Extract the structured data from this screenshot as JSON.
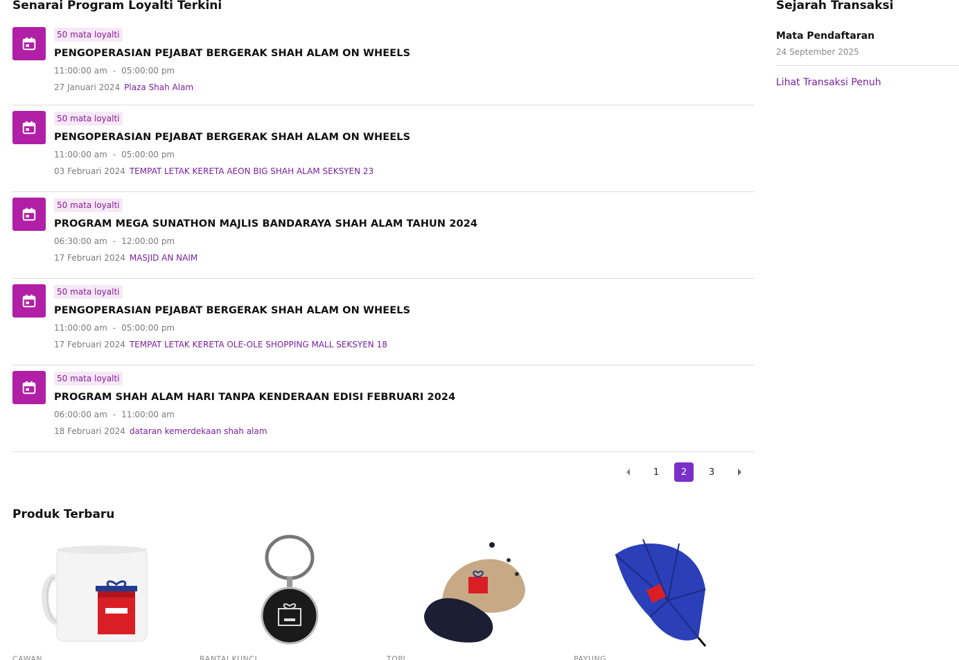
{
  "main": {
    "title": "Senarai Program Loyalti Terkini",
    "programs": [
      {
        "badge": "50 mata loyalti",
        "title": "PENGOPERASIAN PEJABAT BERGERAK SHAH ALAM ON WHEELS",
        "start": "11:00:00 am",
        "end": "05:00:00 pm",
        "date": "27 Januari 2024",
        "location": "Plaza Shah Alam"
      },
      {
        "badge": "50 mata loyalti",
        "title": "PENGOPERASIAN PEJABAT BERGERAK SHAH ALAM ON WHEELS",
        "start": "11:00:00 am",
        "end": "05:00:00 pm",
        "date": "03 Februari 2024",
        "location": "TEMPAT LETAK KERETA AEON BIG SHAH ALAM SEKSYEN 23"
      },
      {
        "badge": "50 mata loyalti",
        "title": "PROGRAM MEGA SUNATHON MAJLIS BANDARAYA SHAH ALAM TAHUN 2024",
        "start": "06:30:00 am",
        "end": "12:00:00 pm",
        "date": "17 Februari 2024",
        "location": "MASJID AN NAIM"
      },
      {
        "badge": "50 mata loyalti",
        "title": "PENGOPERASIAN PEJABAT BERGERAK SHAH ALAM ON WHEELS",
        "start": "11:00:00 am",
        "end": "05:00:00 pm",
        "date": "17 Februari 2024",
        "location": "TEMPAT LETAK KERETA OLE-OLE SHOPPING MALL SEKSYEN 18"
      },
      {
        "badge": "50 mata loyalti",
        "title": "PROGRAM SHAH ALAM HARI TANPA KENDERAAN EDISI FEBRUARI 2024",
        "start": "06:00:00 am",
        "end": "11:00:00 am",
        "date": "18 Februari 2024",
        "location": "dataran kemerdekaan shah alam"
      }
    ],
    "time_separator": "-",
    "pagination": {
      "pages": [
        "1",
        "2",
        "3"
      ],
      "current": "2"
    }
  },
  "products": {
    "title": "Produk Terbaru",
    "items": [
      {
        "name": "CAWAN",
        "icon": "mug-image"
      },
      {
        "name": "RANTAI KUNCI",
        "icon": "keychain-image"
      },
      {
        "name": "TOPI",
        "icon": "cap-image"
      },
      {
        "name": "PAYUNG",
        "icon": "umbrella-image"
      }
    ]
  },
  "sidebar": {
    "title": "Sejarah Transaksi",
    "item_label": "Mata Pendaftaran",
    "item_date": "24 September 2025",
    "link": "Lihat Transaksi Penuh"
  },
  "colors": {
    "accent": "#b01fa6",
    "link": "#7b1fa2",
    "page_active": "#7b2fc9"
  }
}
